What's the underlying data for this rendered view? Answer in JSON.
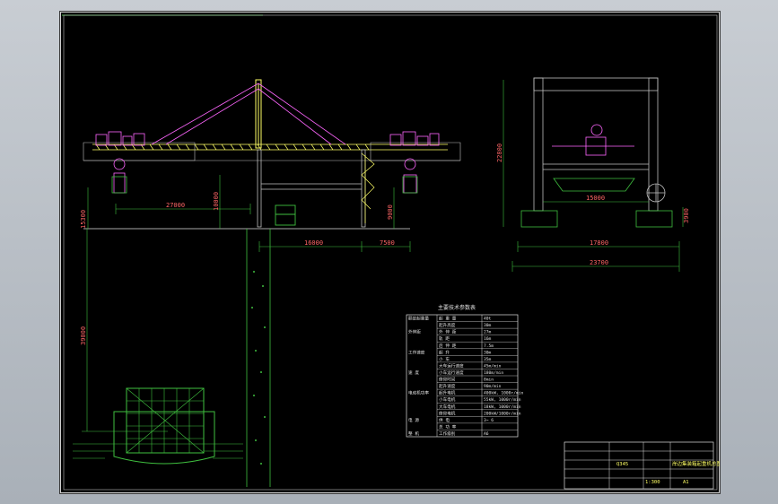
{
  "drawing": {
    "elevation_dims": {
      "span_left": "27000",
      "height_left": "15300",
      "height_mid": "10000",
      "height_right": "9000",
      "rail_span": "16000",
      "right_span": "7500",
      "depth": "39000"
    },
    "side_dims": {
      "height": "22800",
      "inner_width": "15000",
      "wheel_height": "3900",
      "gauge": "17800",
      "overall_width": "23700"
    },
    "table": {
      "title": "主要技术参数表",
      "rows": [
        {
          "label": "额定起重量",
          "item": "起 重 量",
          "value": "40t"
        },
        {
          "label": "",
          "item": "起升高度",
          "value": "30m"
        },
        {
          "label": "外伸距",
          "item": "外 伸 距",
          "value": "27m"
        },
        {
          "label": "",
          "item": "轨 距",
          "value": "16m"
        },
        {
          "label": "",
          "item": "后 伸 距",
          "value": "7.5m"
        },
        {
          "label": "工作速度",
          "item": "起 升",
          "value": "30m"
        },
        {
          "label": "",
          "item": "小 车",
          "value": "35m"
        },
        {
          "label": "",
          "item": "大车运行速度",
          "value": "45m/min"
        },
        {
          "label": "速 度",
          "item": "小车运行速度",
          "value": "180m/min"
        },
        {
          "label": "",
          "item": "俯仰时间",
          "value": "8min"
        },
        {
          "label": "",
          "item": "起升速度",
          "value": "90m/min"
        },
        {
          "label": "电动机功率",
          "item": "起升电机",
          "value": "400kW, 1000r/min"
        },
        {
          "label": "",
          "item": "小车电机",
          "value": "55kW, 1000r/min"
        },
        {
          "label": "",
          "item": "大车电机",
          "value": "18kW, 1000r/min"
        },
        {
          "label": "",
          "item": "俯仰电机",
          "value": "200kW/1000r/min"
        },
        {
          "label": "电 源",
          "item": "供 电",
          "value": "3~ 6"
        },
        {
          "label": "",
          "item": "总 功 率",
          "value": ""
        },
        {
          "label": "整 机",
          "item": "工作级别",
          "value": "A6"
        }
      ]
    },
    "title_block": {
      "drawing_title": "岸边集装箱起重机总图",
      "material": "Q345",
      "scale": "1:300",
      "sheet_no": "A1"
    }
  }
}
